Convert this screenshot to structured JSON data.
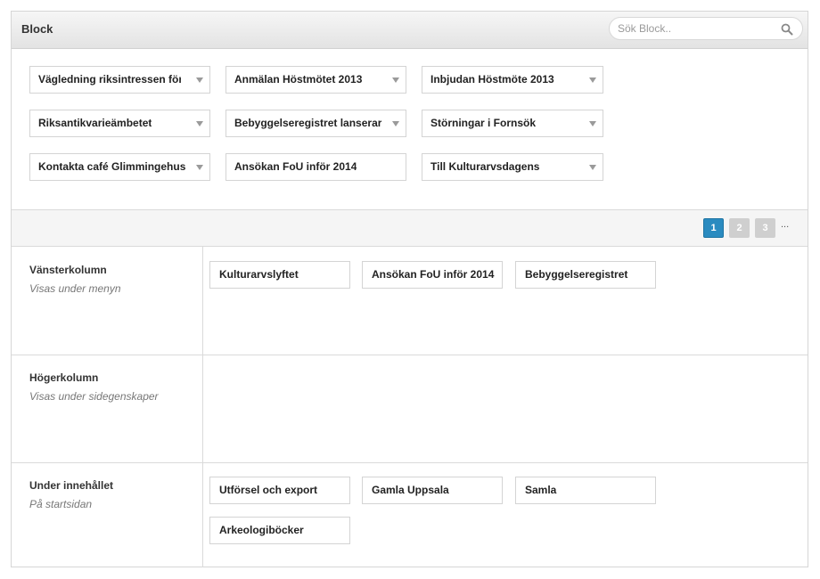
{
  "header": {
    "title": "Block",
    "search_placeholder": "Sök Block.."
  },
  "palette": {
    "blocks": [
      {
        "label": "Vägledning riksintressen för",
        "dropdown": true
      },
      {
        "label": "Anmälan Höstmötet 2013",
        "dropdown": true
      },
      {
        "label": "Inbjudan Höstmöte 2013",
        "dropdown": true
      },
      {
        "label": "Riksantikvarieämbetet",
        "dropdown": true
      },
      {
        "label": "Bebyggelseregistret lanserar",
        "dropdown": true
      },
      {
        "label": "Störningar i Fornsök",
        "dropdown": true
      },
      {
        "label": "Kontakta café Glimmingehus",
        "dropdown": true
      },
      {
        "label": "Ansökan FoU inför 2014",
        "dropdown": false
      },
      {
        "label": "Till Kulturarvsdagens",
        "dropdown": true
      }
    ]
  },
  "pagination": {
    "pages": [
      "1",
      "2",
      "3"
    ],
    "current": "1",
    "more": "..."
  },
  "regions": [
    {
      "title": "Vänsterkolumn",
      "description": "Visas under menyn",
      "blocks": [
        "Kulturarvslyftet",
        "Ansökan FoU inför 2014",
        "Bebyggelseregistret"
      ]
    },
    {
      "title": "Högerkolumn",
      "description": "Visas under sidegenskaper",
      "blocks": []
    },
    {
      "title": "Under innehållet",
      "description": "På startsidan",
      "blocks": [
        "Utförsel och export",
        "Gamla Uppsala",
        "Samla",
        "Arkeologiböcker"
      ]
    }
  ],
  "colors": {
    "accent": "#2a8bc0",
    "inactive_page": "#cfcfcf",
    "border": "#d4d4d4"
  }
}
